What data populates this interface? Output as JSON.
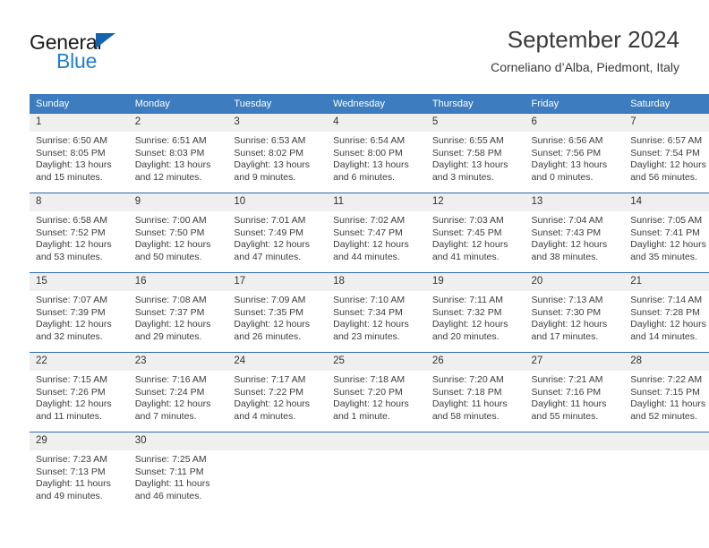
{
  "brand": {
    "name_top": "General",
    "name_bottom": "Blue",
    "triangle_color": "#1464ad",
    "blue_color": "#1f7fd0"
  },
  "header": {
    "title": "September 2024",
    "subtitle": "Corneliano d’Alba, Piedmont, Italy"
  },
  "theme": {
    "header_bg": "#3d7cbf",
    "header_text": "#ffffff",
    "row_border": "#2f6cab",
    "daynum_bg": "#efefef"
  },
  "weekday_headers": [
    "Sunday",
    "Monday",
    "Tuesday",
    "Wednesday",
    "Thursday",
    "Friday",
    "Saturday"
  ],
  "days": [
    {
      "n": "1",
      "sunrise": "Sunrise: 6:50 AM",
      "sunset": "Sunset: 8:05 PM",
      "daylight": "Daylight: 13 hours and 15 minutes."
    },
    {
      "n": "2",
      "sunrise": "Sunrise: 6:51 AM",
      "sunset": "Sunset: 8:03 PM",
      "daylight": "Daylight: 13 hours and 12 minutes."
    },
    {
      "n": "3",
      "sunrise": "Sunrise: 6:53 AM",
      "sunset": "Sunset: 8:02 PM",
      "daylight": "Daylight: 13 hours and 9 minutes."
    },
    {
      "n": "4",
      "sunrise": "Sunrise: 6:54 AM",
      "sunset": "Sunset: 8:00 PM",
      "daylight": "Daylight: 13 hours and 6 minutes."
    },
    {
      "n": "5",
      "sunrise": "Sunrise: 6:55 AM",
      "sunset": "Sunset: 7:58 PM",
      "daylight": "Daylight: 13 hours and 3 minutes."
    },
    {
      "n": "6",
      "sunrise": "Sunrise: 6:56 AM",
      "sunset": "Sunset: 7:56 PM",
      "daylight": "Daylight: 13 hours and 0 minutes."
    },
    {
      "n": "7",
      "sunrise": "Sunrise: 6:57 AM",
      "sunset": "Sunset: 7:54 PM",
      "daylight": "Daylight: 12 hours and 56 minutes."
    },
    {
      "n": "8",
      "sunrise": "Sunrise: 6:58 AM",
      "sunset": "Sunset: 7:52 PM",
      "daylight": "Daylight: 12 hours and 53 minutes."
    },
    {
      "n": "9",
      "sunrise": "Sunrise: 7:00 AM",
      "sunset": "Sunset: 7:50 PM",
      "daylight": "Daylight: 12 hours and 50 minutes."
    },
    {
      "n": "10",
      "sunrise": "Sunrise: 7:01 AM",
      "sunset": "Sunset: 7:49 PM",
      "daylight": "Daylight: 12 hours and 47 minutes."
    },
    {
      "n": "11",
      "sunrise": "Sunrise: 7:02 AM",
      "sunset": "Sunset: 7:47 PM",
      "daylight": "Daylight: 12 hours and 44 minutes."
    },
    {
      "n": "12",
      "sunrise": "Sunrise: 7:03 AM",
      "sunset": "Sunset: 7:45 PM",
      "daylight": "Daylight: 12 hours and 41 minutes."
    },
    {
      "n": "13",
      "sunrise": "Sunrise: 7:04 AM",
      "sunset": "Sunset: 7:43 PM",
      "daylight": "Daylight: 12 hours and 38 minutes."
    },
    {
      "n": "14",
      "sunrise": "Sunrise: 7:05 AM",
      "sunset": "Sunset: 7:41 PM",
      "daylight": "Daylight: 12 hours and 35 minutes."
    },
    {
      "n": "15",
      "sunrise": "Sunrise: 7:07 AM",
      "sunset": "Sunset: 7:39 PM",
      "daylight": "Daylight: 12 hours and 32 minutes."
    },
    {
      "n": "16",
      "sunrise": "Sunrise: 7:08 AM",
      "sunset": "Sunset: 7:37 PM",
      "daylight": "Daylight: 12 hours and 29 minutes."
    },
    {
      "n": "17",
      "sunrise": "Sunrise: 7:09 AM",
      "sunset": "Sunset: 7:35 PM",
      "daylight": "Daylight: 12 hours and 26 minutes."
    },
    {
      "n": "18",
      "sunrise": "Sunrise: 7:10 AM",
      "sunset": "Sunset: 7:34 PM",
      "daylight": "Daylight: 12 hours and 23 minutes."
    },
    {
      "n": "19",
      "sunrise": "Sunrise: 7:11 AM",
      "sunset": "Sunset: 7:32 PM",
      "daylight": "Daylight: 12 hours and 20 minutes."
    },
    {
      "n": "20",
      "sunrise": "Sunrise: 7:13 AM",
      "sunset": "Sunset: 7:30 PM",
      "daylight": "Daylight: 12 hours and 17 minutes."
    },
    {
      "n": "21",
      "sunrise": "Sunrise: 7:14 AM",
      "sunset": "Sunset: 7:28 PM",
      "daylight": "Daylight: 12 hours and 14 minutes."
    },
    {
      "n": "22",
      "sunrise": "Sunrise: 7:15 AM",
      "sunset": "Sunset: 7:26 PM",
      "daylight": "Daylight: 12 hours and 11 minutes."
    },
    {
      "n": "23",
      "sunrise": "Sunrise: 7:16 AM",
      "sunset": "Sunset: 7:24 PM",
      "daylight": "Daylight: 12 hours and 7 minutes."
    },
    {
      "n": "24",
      "sunrise": "Sunrise: 7:17 AM",
      "sunset": "Sunset: 7:22 PM",
      "daylight": "Daylight: 12 hours and 4 minutes."
    },
    {
      "n": "25",
      "sunrise": "Sunrise: 7:18 AM",
      "sunset": "Sunset: 7:20 PM",
      "daylight": "Daylight: 12 hours and 1 minute."
    },
    {
      "n": "26",
      "sunrise": "Sunrise: 7:20 AM",
      "sunset": "Sunset: 7:18 PM",
      "daylight": "Daylight: 11 hours and 58 minutes."
    },
    {
      "n": "27",
      "sunrise": "Sunrise: 7:21 AM",
      "sunset": "Sunset: 7:16 PM",
      "daylight": "Daylight: 11 hours and 55 minutes."
    },
    {
      "n": "28",
      "sunrise": "Sunrise: 7:22 AM",
      "sunset": "Sunset: 7:15 PM",
      "daylight": "Daylight: 11 hours and 52 minutes."
    },
    {
      "n": "29",
      "sunrise": "Sunrise: 7:23 AM",
      "sunset": "Sunset: 7:13 PM",
      "daylight": "Daylight: 11 hours and 49 minutes."
    },
    {
      "n": "30",
      "sunrise": "Sunrise: 7:25 AM",
      "sunset": "Sunset: 7:11 PM",
      "daylight": "Daylight: 11 hours and 46 minutes."
    }
  ],
  "grid": {
    "first_day_column_index": 0,
    "rows": 5,
    "columns": 7
  }
}
